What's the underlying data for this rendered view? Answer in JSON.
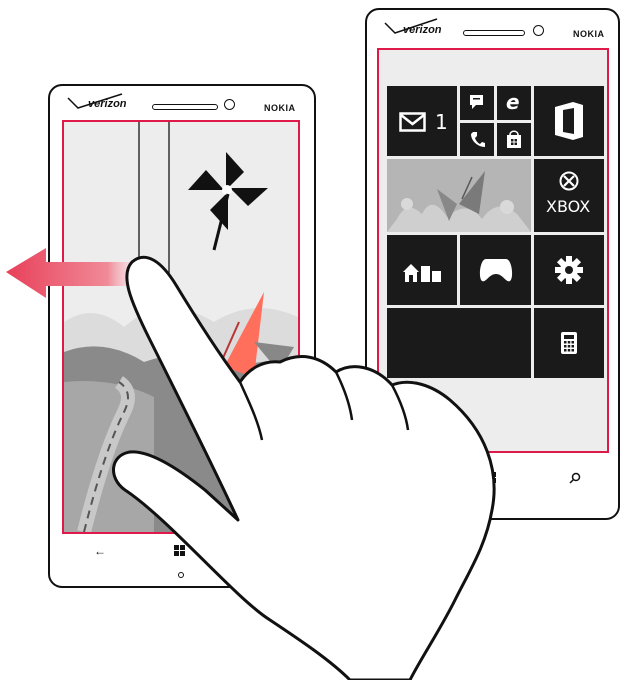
{
  "phones": {
    "front": {
      "carrier": "verizon",
      "brand": "NOKIA"
    },
    "back": {
      "carrier": "verizon",
      "brand": "NOKIA"
    }
  },
  "tiles": {
    "messaging_count": "1",
    "xbox_label": "XBOX"
  },
  "icons": [
    "mail-icon",
    "messaging-icon",
    "internet-explorer-icon",
    "phone-icon",
    "store-icon",
    "office-icon",
    "xbox-icon",
    "photos-tile",
    "home-icon",
    "games-icon",
    "settings-icon",
    "calculator-icon",
    "windows-icon",
    "search-icon",
    "back-icon",
    "pinwheel-icon",
    "swipe-arrow",
    "hand-illustration"
  ],
  "colors": {
    "screen_outline": "#e0194b",
    "tile": "#1a1a1a",
    "arrow": "#e8405a"
  }
}
